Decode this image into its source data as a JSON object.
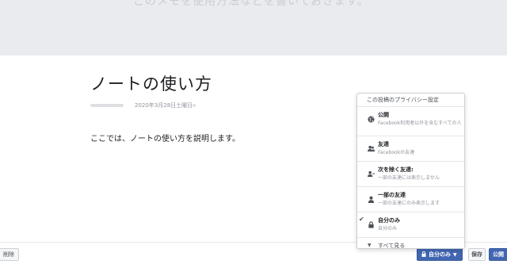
{
  "cover": {
    "text": "このメモを使用方法などを書いておきます。"
  },
  "note": {
    "title": "ノートの使い方",
    "date": "2020年3月28日土曜日",
    "body": "ここでは、ノートの使い方を説明します。"
  },
  "privacy_menu": {
    "header": "この投稿のプライバシー設定",
    "items": [
      {
        "label": "公開",
        "desc": "Facebook利用者以外を含むすべての人",
        "icon": "globe-icon"
      },
      {
        "label": "友達",
        "desc": "Facebookの友達",
        "icon": "friends-icon"
      },
      {
        "label": "次を除く友達:",
        "desc": "一部の友達には表示しません",
        "icon": "friends-except-icon"
      },
      {
        "label": "一部の友達",
        "desc": "一部の友達にのみ表示します",
        "icon": "person-icon"
      },
      {
        "label": "自分のみ",
        "desc": "自分のみ",
        "icon": "lock-icon",
        "selected": true
      }
    ],
    "see_all": "すべて見る"
  },
  "toolbar": {
    "delete_label": "削除",
    "privacy_label": "自分のみ",
    "save_label": "保存",
    "publish_label": "公開"
  },
  "colors": {
    "accent": "#4267b2",
    "cover_bg": "#e9ebee"
  }
}
